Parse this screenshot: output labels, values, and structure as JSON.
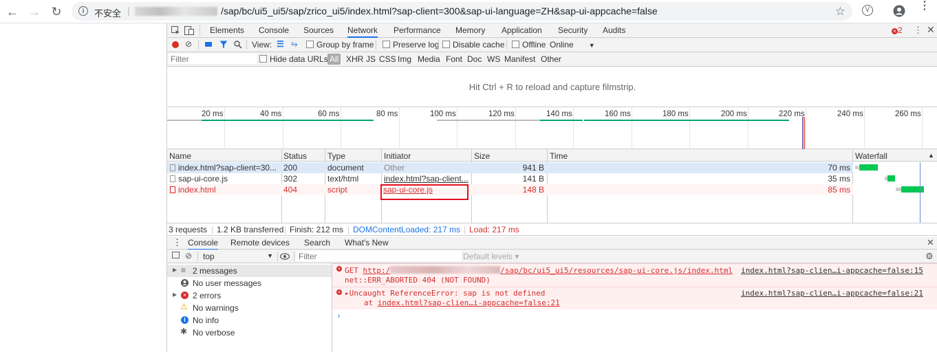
{
  "browser": {
    "back_glyph": "←",
    "forward_glyph": "→",
    "reload_glyph": "↻",
    "insecure_label": "不安全",
    "url": "/sap/bc/ui5_ui5/sap/zrico_ui5/index.html?sap-client=300&sap-ui-language=ZH&sap-ui-appcache=false"
  },
  "devtools": {
    "tabs": [
      "Elements",
      "Console",
      "Sources",
      "Network",
      "Performance",
      "Memory",
      "Application",
      "Security",
      "Audits"
    ],
    "active_tab": "Network",
    "error_count": "2",
    "network_toolbar": {
      "view_label": "View:",
      "group_by_frame": "Group by frame",
      "preserve_log": "Preserve log",
      "disable_cache": "Disable cache",
      "offline": "Offline",
      "throttle": "Online"
    },
    "filter_bar": {
      "placeholder": "Filter",
      "hide_data_urls": "Hide data URLs",
      "types": [
        "All",
        "XHR",
        "JS",
        "CSS",
        "Img",
        "Media",
        "Font",
        "Doc",
        "WS",
        "Manifest",
        "Other"
      ]
    },
    "filmstrip_message": "Hit Ctrl + R to reload and capture filmstrip.",
    "timeline_ticks": [
      "20 ms",
      "40 ms",
      "60 ms",
      "80 ms",
      "100 ms",
      "120 ms",
      "140 ms",
      "160 ms",
      "180 ms",
      "200 ms",
      "220 ms",
      "240 ms",
      "260 ms"
    ],
    "table": {
      "headers": {
        "name": "Name",
        "status": "Status",
        "type": "Type",
        "initiator": "Initiator",
        "size": "Size",
        "time": "Time",
        "waterfall": "Waterfall"
      },
      "rows": [
        {
          "name": "index.html?sap-client=30...",
          "status": "200",
          "type": "document",
          "initiator": "Other",
          "size": "941 B",
          "time": "70 ms",
          "error": false
        },
        {
          "name": "sap-ui-core.js",
          "status": "302",
          "type": "text/html",
          "initiator": "index.html?sap-client...",
          "size": "141 B",
          "time": "35 ms",
          "error": false
        },
        {
          "name": "index.html",
          "status": "404",
          "type": "script",
          "initiator": "sap-ui-core.js",
          "size": "148 B",
          "time": "85 ms",
          "error": true
        }
      ]
    },
    "status_bar": {
      "requests": "3 requests",
      "transferred": "1.2 KB transferred",
      "finish": "Finish: 212 ms",
      "dom_content_loaded": "DOMContentLoaded: 217 ms",
      "load": "Load: 217 ms"
    },
    "drawer_tabs": [
      "Console",
      "Remote devices",
      "Search",
      "What's New"
    ],
    "console_toolbar": {
      "context": "top",
      "filter_placeholder": "Filter",
      "levels": "Default levels ▾"
    },
    "console_sidebar": [
      {
        "label": "2 messages",
        "icon": "list-icon"
      },
      {
        "label": "No user messages",
        "icon": "user-icon"
      },
      {
        "label": "2 errors",
        "icon": "error-icon"
      },
      {
        "label": "No warnings",
        "icon": "warning-icon"
      },
      {
        "label": "No info",
        "icon": "info-icon"
      },
      {
        "label": "No verbose",
        "icon": "bug-icon"
      }
    ],
    "console_messages": [
      {
        "line1_prefix": "GET ",
        "line1_url_start": "http:/",
        "line1_url_end": "/sap/bc/ui5_ui5/resources/sap-ui-core.js/index.html",
        "line2": "net::ERR_ABORTED 404 (NOT FOUND)",
        "source": "index.html?sap-clien…i-appcache=false:15"
      },
      {
        "line1": "▸Uncaught ReferenceError: sap is not defined",
        "line2_prefix": "at ",
        "line2_link": "index.html?sap-clien…i-appcache=false:21",
        "source": "index.html?sap-clien…i-appcache=false:21"
      }
    ],
    "colors": {
      "accent": "#1a73e8",
      "error": "#d32f2f",
      "waterfall_green": "#00c853",
      "highlight": "#e3101e"
    }
  }
}
